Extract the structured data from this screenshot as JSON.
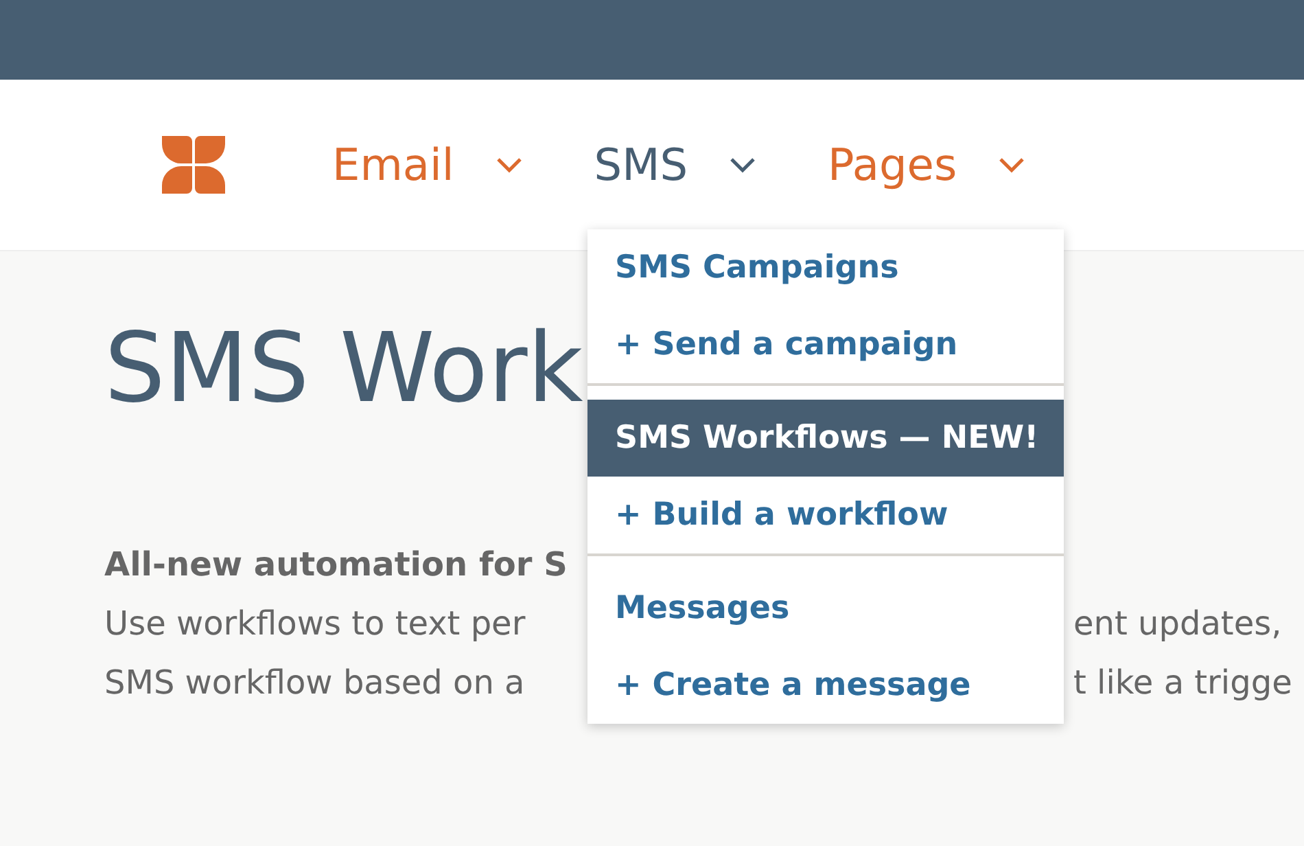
{
  "nav": [
    {
      "label": "Email",
      "open": false
    },
    {
      "label": "SMS",
      "open": true
    },
    {
      "label": "Pages",
      "open": false
    }
  ],
  "page": {
    "title": "SMS Work",
    "intro_bold": "All-new automation for S",
    "lines": [
      {
        "left": "Use workflows to text per",
        "right": "ent updates,"
      },
      {
        "left": "SMS workflow based on a",
        "right": "t like a trigge"
      }
    ]
  },
  "menu": {
    "groups": [
      {
        "items": [
          {
            "label": "SMS Campaigns",
            "kind": "link",
            "selected": false
          },
          {
            "label": "+ Send a campaign",
            "kind": "link",
            "selected": false
          }
        ]
      },
      {
        "items": [
          {
            "label": "SMS Workflows — NEW!",
            "kind": "link",
            "selected": true
          },
          {
            "label": "+ Build a workflow",
            "kind": "link",
            "selected": false
          }
        ]
      },
      {
        "items": [
          {
            "label": "Messages",
            "kind": "link",
            "selected": false
          },
          {
            "label": "+ Create a message",
            "kind": "link",
            "selected": false
          }
        ]
      }
    ]
  }
}
